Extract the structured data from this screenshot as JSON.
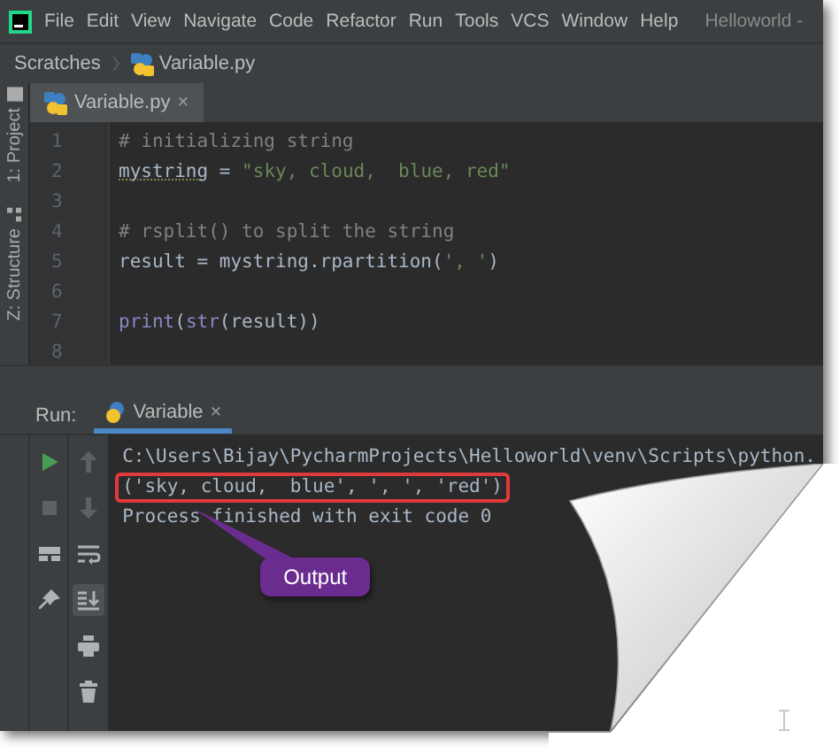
{
  "menu_bar": {
    "items": [
      "File",
      "Edit",
      "View",
      "Navigate",
      "Code",
      "Refactor",
      "Run",
      "Tools",
      "VCS",
      "Window",
      "Help"
    ],
    "window_title": "Helloworld -"
  },
  "breadcrumb": [
    "Scratches",
    "Variable.py"
  ],
  "editor_tabs": [
    {
      "label": "Variable.py",
      "close": "×",
      "selected": true
    }
  ],
  "side_tools": [
    "1: Project",
    "Z: Structure"
  ],
  "editor": {
    "lines": [
      {
        "number": "1",
        "tokens": [
          {
            "kind": "comment",
            "text": "# initializing string"
          }
        ]
      },
      {
        "number": "2",
        "tokens": [
          {
            "kind": "warning",
            "text": "mystring"
          },
          {
            "kind": "plain",
            "text": " = "
          },
          {
            "kind": "string",
            "text": "\"sky, cloud,  blue, red\""
          }
        ]
      },
      {
        "number": "3"
      },
      {
        "number": "4",
        "tokens": [
          {
            "kind": "comment",
            "text": "# rsplit() to split the string"
          }
        ]
      },
      {
        "number": "5",
        "tokens": [
          {
            "kind": "plain",
            "text": "result = mystring.rpartition("
          },
          {
            "kind": "string",
            "text": "', '"
          },
          {
            "kind": "plain",
            "text": ")"
          }
        ]
      },
      {
        "number": "6"
      },
      {
        "number": "7",
        "tokens": [
          {
            "kind": "builtin",
            "text": "print"
          },
          {
            "kind": "plain",
            "text": "("
          },
          {
            "kind": "builtin",
            "text": "str"
          },
          {
            "kind": "plain",
            "text": "(result))"
          }
        ]
      },
      {
        "number": "8"
      }
    ]
  },
  "run_panel": {
    "label": "Run:",
    "tabs": [
      {
        "label": "Variable",
        "close": "×",
        "selected": true
      }
    ],
    "tools_left": [
      {
        "kind": "play",
        "disabled": false
      },
      {
        "kind": "stop",
        "disabled": true
      },
      {
        "kind": "layout",
        "disabled": false
      },
      {
        "kind": "pin",
        "disabled": false
      }
    ],
    "tools_right": [
      {
        "kind": "up",
        "disabled": true,
        "on": false
      },
      {
        "kind": "down",
        "disabled": true,
        "on": false
      },
      {
        "kind": "wrap",
        "disabled": false,
        "on": false
      },
      {
        "kind": "scroll",
        "disabled": false,
        "on": true
      },
      {
        "kind": "print",
        "disabled": false,
        "on": false
      },
      {
        "kind": "trash",
        "disabled": false,
        "on": false
      }
    ],
    "console": [
      {
        "text": "C:\\Users\\Bijay\\PycharmProjects\\Helloworld\\venv\\Scripts\\python.",
        "boxed": false
      },
      {
        "text": "('sky, cloud,  blue', ', ', 'red')",
        "boxed": true
      },
      {
        "text": "Process finished with exit code 0",
        "boxed": false
      }
    ],
    "callout": {
      "text": "Output"
    }
  }
}
